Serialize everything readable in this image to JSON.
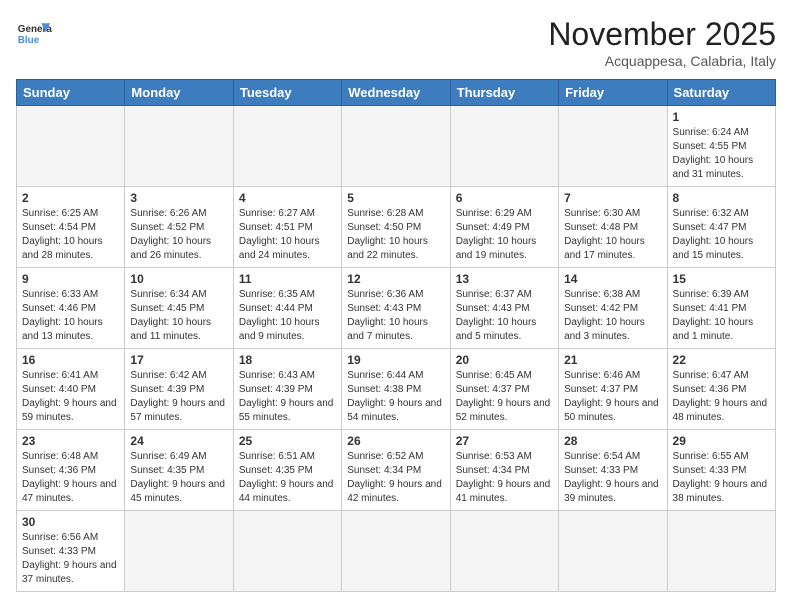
{
  "logo": {
    "text_general": "General",
    "text_blue": "Blue"
  },
  "title": "November 2025",
  "subtitle": "Acquappesa, Calabria, Italy",
  "headers": [
    "Sunday",
    "Monday",
    "Tuesday",
    "Wednesday",
    "Thursday",
    "Friday",
    "Saturday"
  ],
  "days": [
    {
      "num": "",
      "info": ""
    },
    {
      "num": "",
      "info": ""
    },
    {
      "num": "",
      "info": ""
    },
    {
      "num": "",
      "info": ""
    },
    {
      "num": "",
      "info": ""
    },
    {
      "num": "",
      "info": ""
    },
    {
      "num": "1",
      "info": "Sunrise: 6:24 AM\nSunset: 4:55 PM\nDaylight: 10 hours and 31 minutes."
    },
    {
      "num": "2",
      "info": "Sunrise: 6:25 AM\nSunset: 4:54 PM\nDaylight: 10 hours and 28 minutes."
    },
    {
      "num": "3",
      "info": "Sunrise: 6:26 AM\nSunset: 4:52 PM\nDaylight: 10 hours and 26 minutes."
    },
    {
      "num": "4",
      "info": "Sunrise: 6:27 AM\nSunset: 4:51 PM\nDaylight: 10 hours and 24 minutes."
    },
    {
      "num": "5",
      "info": "Sunrise: 6:28 AM\nSunset: 4:50 PM\nDaylight: 10 hours and 22 minutes."
    },
    {
      "num": "6",
      "info": "Sunrise: 6:29 AM\nSunset: 4:49 PM\nDaylight: 10 hours and 19 minutes."
    },
    {
      "num": "7",
      "info": "Sunrise: 6:30 AM\nSunset: 4:48 PM\nDaylight: 10 hours and 17 minutes."
    },
    {
      "num": "8",
      "info": "Sunrise: 6:32 AM\nSunset: 4:47 PM\nDaylight: 10 hours and 15 minutes."
    },
    {
      "num": "9",
      "info": "Sunrise: 6:33 AM\nSunset: 4:46 PM\nDaylight: 10 hours and 13 minutes."
    },
    {
      "num": "10",
      "info": "Sunrise: 6:34 AM\nSunset: 4:45 PM\nDaylight: 10 hours and 11 minutes."
    },
    {
      "num": "11",
      "info": "Sunrise: 6:35 AM\nSunset: 4:44 PM\nDaylight: 10 hours and 9 minutes."
    },
    {
      "num": "12",
      "info": "Sunrise: 6:36 AM\nSunset: 4:43 PM\nDaylight: 10 hours and 7 minutes."
    },
    {
      "num": "13",
      "info": "Sunrise: 6:37 AM\nSunset: 4:43 PM\nDaylight: 10 hours and 5 minutes."
    },
    {
      "num": "14",
      "info": "Sunrise: 6:38 AM\nSunset: 4:42 PM\nDaylight: 10 hours and 3 minutes."
    },
    {
      "num": "15",
      "info": "Sunrise: 6:39 AM\nSunset: 4:41 PM\nDaylight: 10 hours and 1 minute."
    },
    {
      "num": "16",
      "info": "Sunrise: 6:41 AM\nSunset: 4:40 PM\nDaylight: 9 hours and 59 minutes."
    },
    {
      "num": "17",
      "info": "Sunrise: 6:42 AM\nSunset: 4:39 PM\nDaylight: 9 hours and 57 minutes."
    },
    {
      "num": "18",
      "info": "Sunrise: 6:43 AM\nSunset: 4:39 PM\nDaylight: 9 hours and 55 minutes."
    },
    {
      "num": "19",
      "info": "Sunrise: 6:44 AM\nSunset: 4:38 PM\nDaylight: 9 hours and 54 minutes."
    },
    {
      "num": "20",
      "info": "Sunrise: 6:45 AM\nSunset: 4:37 PM\nDaylight: 9 hours and 52 minutes."
    },
    {
      "num": "21",
      "info": "Sunrise: 6:46 AM\nSunset: 4:37 PM\nDaylight: 9 hours and 50 minutes."
    },
    {
      "num": "22",
      "info": "Sunrise: 6:47 AM\nSunset: 4:36 PM\nDaylight: 9 hours and 48 minutes."
    },
    {
      "num": "23",
      "info": "Sunrise: 6:48 AM\nSunset: 4:36 PM\nDaylight: 9 hours and 47 minutes."
    },
    {
      "num": "24",
      "info": "Sunrise: 6:49 AM\nSunset: 4:35 PM\nDaylight: 9 hours and 45 minutes."
    },
    {
      "num": "25",
      "info": "Sunrise: 6:51 AM\nSunset: 4:35 PM\nDaylight: 9 hours and 44 minutes."
    },
    {
      "num": "26",
      "info": "Sunrise: 6:52 AM\nSunset: 4:34 PM\nDaylight: 9 hours and 42 minutes."
    },
    {
      "num": "27",
      "info": "Sunrise: 6:53 AM\nSunset: 4:34 PM\nDaylight: 9 hours and 41 minutes."
    },
    {
      "num": "28",
      "info": "Sunrise: 6:54 AM\nSunset: 4:33 PM\nDaylight: 9 hours and 39 minutes."
    },
    {
      "num": "29",
      "info": "Sunrise: 6:55 AM\nSunset: 4:33 PM\nDaylight: 9 hours and 38 minutes."
    },
    {
      "num": "30",
      "info": "Sunrise: 6:56 AM\nSunset: 4:33 PM\nDaylight: 9 hours and 37 minutes."
    },
    {
      "num": "",
      "info": ""
    },
    {
      "num": "",
      "info": ""
    },
    {
      "num": "",
      "info": ""
    },
    {
      "num": "",
      "info": ""
    },
    {
      "num": "",
      "info": ""
    },
    {
      "num": "",
      "info": ""
    }
  ]
}
